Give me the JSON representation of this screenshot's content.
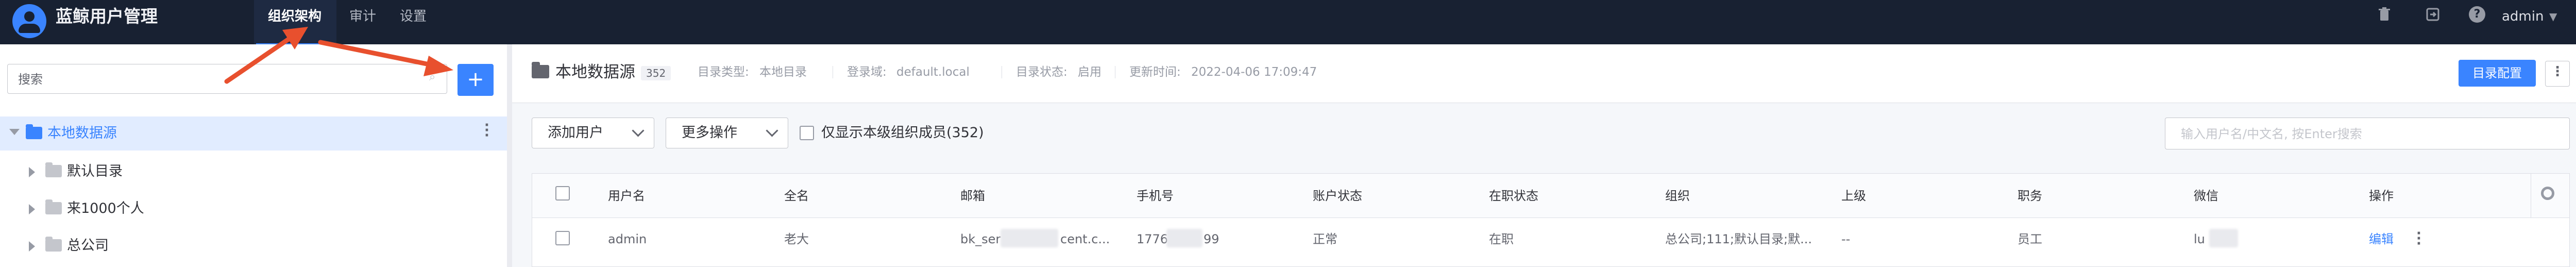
{
  "app": {
    "title": "蓝鲸用户管理",
    "nav": [
      "组织架构",
      "审计",
      "设置"
    ],
    "user": "admin"
  },
  "sidebar": {
    "search_placeholder": "搜索",
    "add_button": "+",
    "tree": [
      {
        "label": "本地数据源",
        "expanded": true,
        "selected": true
      },
      {
        "label": "默认目录"
      },
      {
        "label": "来1000个人"
      },
      {
        "label": "总公司"
      }
    ]
  },
  "header": {
    "title": "本地数据源",
    "count": "352",
    "directory_type_label": "目录类型:",
    "directory_type": "本地目录",
    "login_domain_label": "登录域:",
    "login_domain": "default.local",
    "status_label": "目录状态:",
    "status": "启用",
    "update_time_label": "更新时间:",
    "update_time": "2022-04-06 17:09:47",
    "config_button": "目录配置"
  },
  "toolbar": {
    "add_user": "添加用户",
    "more_actions": "更多操作",
    "only_current_level": "仅显示本级组织成员(352)",
    "search_placeholder": "输入用户名/中文名, 按Enter搜索"
  },
  "table": {
    "columns": [
      "用户名",
      "全名",
      "邮箱",
      "手机号",
      "账户状态",
      "在职状态",
      "组织",
      "上级",
      "职务",
      "微信",
      "操作"
    ],
    "rows": [
      {
        "username": "admin",
        "fullname": "老大",
        "email_start": "bk_ser",
        "email_end": "cent.c...",
        "phone_start": "1776",
        "phone_end": "99",
        "account_status": "正常",
        "employment_status": "在职",
        "organization": "总公司;111;默认目录;默...",
        "superior": "--",
        "position": "员工",
        "wechat": "lu",
        "action": "编辑"
      }
    ]
  },
  "colors": {
    "topbar": "#182132",
    "primary": "#3a84ff",
    "annotation": "#e8502e"
  }
}
